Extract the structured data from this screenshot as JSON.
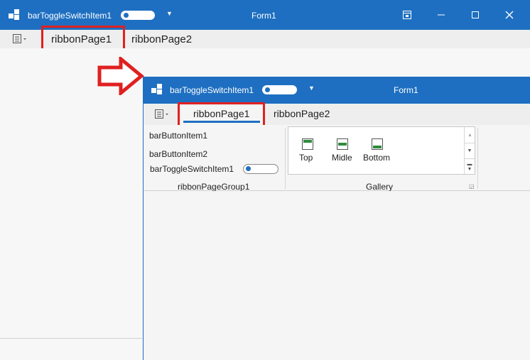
{
  "back_window": {
    "qat_toggle_label": "barToggleSwitchItem1",
    "title": "Form1",
    "tabs": [
      "ribbonPage1",
      "ribbonPage2"
    ]
  },
  "front_window": {
    "qat_toggle_label": "barToggleSwitchItem1",
    "title": "Form1",
    "tabs": [
      "ribbonPage1",
      "ribbonPage2"
    ],
    "group1": {
      "items": [
        "barButtonItem1",
        "barButtonItem2",
        "barToggleSwitchItem1"
      ],
      "caption": "ribbonPageGroup1"
    },
    "gallery": {
      "items": [
        "Top",
        "Midle",
        "Bottom"
      ],
      "caption": "Gallery"
    }
  },
  "colors": {
    "titlebar": "#1e6fc1",
    "highlight": "#e02020",
    "tab_underline": "#1e6fc1",
    "icon_green": "#2e8b3e"
  }
}
